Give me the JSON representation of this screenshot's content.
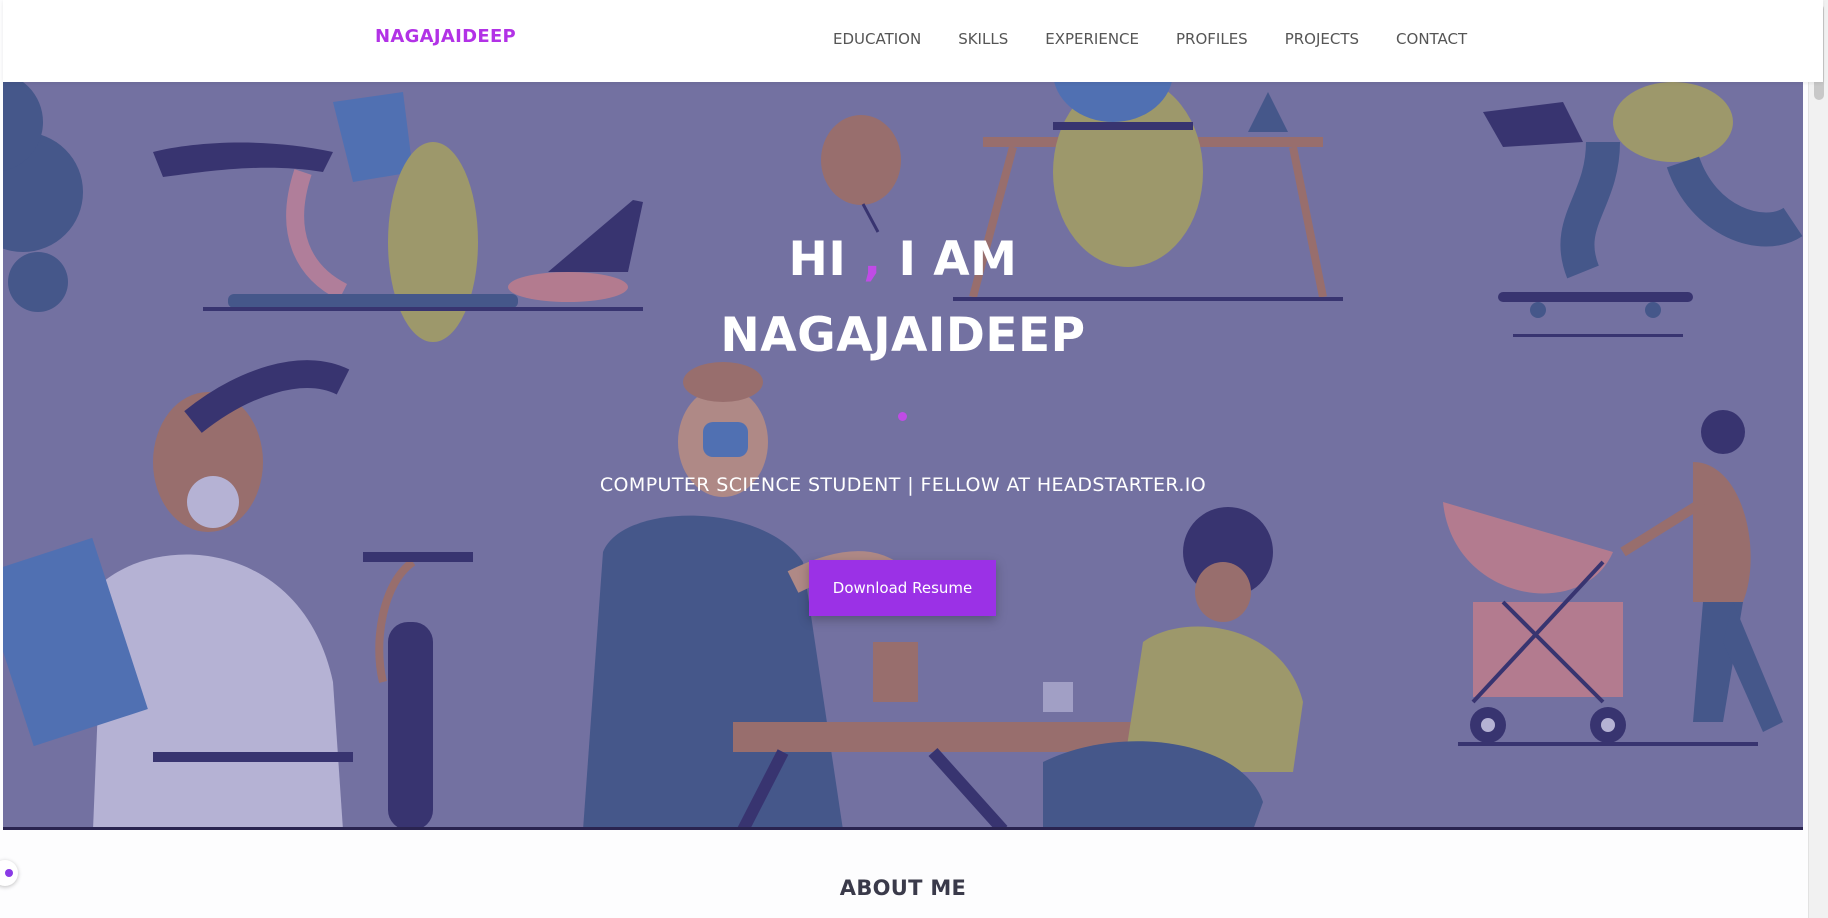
{
  "navbar": {
    "brand": "NAGAJAIDEEP",
    "links": [
      "EDUCATION",
      "SKILLS",
      "EXPERIENCE",
      "PROFILES",
      "PROJECTS",
      "CONTACT"
    ]
  },
  "hero": {
    "greeting_part1": "HI ",
    "greeting_comma": ",",
    "greeting_part2": " I AM",
    "name": "NAGAJAIDEEP",
    "subtitle": "COMPUTER SCIENCE STUDENT | FELLOW AT HEADSTARTER.IO",
    "button_label": "Download Resume"
  },
  "about": {
    "title": "ABOUT ME"
  },
  "colors": {
    "accent": "#9b31e6",
    "brand": "#b232e6"
  }
}
